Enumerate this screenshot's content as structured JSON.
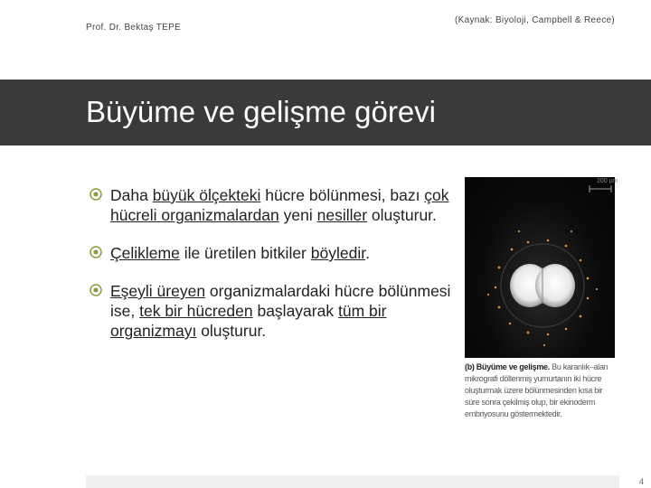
{
  "header": {
    "author": "Prof. Dr. Bektaş TEPE",
    "source": "(Kaynak: Biyoloji, Campbell & Reece)"
  },
  "title": "Büyüme ve gelişme görevi",
  "bullets": [
    {
      "parts": [
        "Daha ",
        "büyük ölçekteki",
        " hücre bölünmesi, bazı ",
        "çok hücreli organizmalardan",
        " yeni ",
        "nesiller",
        " oluşturur."
      ]
    },
    {
      "parts": [
        "Çelikleme",
        " ile üretilen bitkiler ",
        "böyledir",
        "."
      ]
    },
    {
      "parts": [
        "Eşeyli üreyen",
        " organizmalardaki hücre bölünmesi ise, ",
        "tek bir hücreden",
        " başlayarak ",
        "tüm bir organizmayı",
        " oluşturur."
      ]
    }
  ],
  "figure": {
    "scale_label": "200 μm",
    "caption_bold": "(b) Büyüme ve gelişme.",
    "caption_text": " Bu karanlık–alan mikrografi döllenmiş yumurtanın iki hücre oluşturmak üzere bölünmesinden kısa bir süre sonra çekilmiş olup, bir ekinoderm embriyosunu göstermektedir."
  },
  "page_number": "4",
  "colors": {
    "title_bar": "#3a3a3a",
    "bullet_marker": "#8a9a3a"
  }
}
